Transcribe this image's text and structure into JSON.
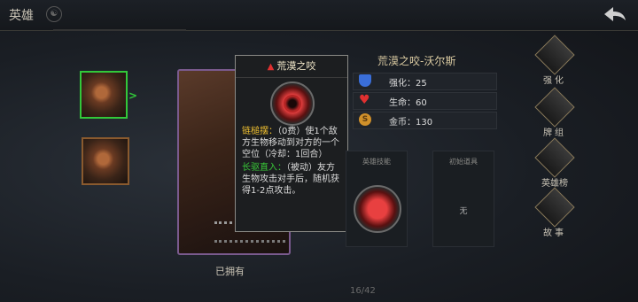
{
  "header": {
    "title": "英雄"
  },
  "card": {
    "owned_label": "已拥有"
  },
  "pagination": {
    "text": "16/42"
  },
  "tooltip": {
    "title": "荒漠之咬",
    "skill1_name": "链槌摆：",
    "skill1_desc": "（0费）使1个敌方生物移动到对方的一个空位（冷却：1回合）",
    "skill2_name": "长驱直入：",
    "skill2_desc": "（被动）友方生物攻击对手后，随机获得1-2点攻击。"
  },
  "hero": {
    "name": "荒漠之咬-沃尔斯",
    "stats": [
      {
        "label": "强化：",
        "value": "25",
        "icon": "shield-icon",
        "color": "#3a6ed8"
      },
      {
        "label": "生命：",
        "value": "60",
        "icon": "heart-icon",
        "color": "#e03030"
      },
      {
        "label": "金币：",
        "value": "130",
        "icon": "coin-icon",
        "color": "#d0902a"
      }
    ]
  },
  "panels": {
    "skill_title": "英雄技能",
    "item_title": "初始道具",
    "item_value": "无"
  },
  "menu": [
    {
      "label": "强化",
      "icon": "enhance-icon"
    },
    {
      "label": "牌组",
      "icon": "deck-icon"
    },
    {
      "label": "英雄榜",
      "icon": "ranking-icon"
    },
    {
      "label": "故事",
      "icon": "story-icon"
    }
  ],
  "colors": {
    "selection": "#32c83a",
    "accent_gold": "#f0c030",
    "accent_green": "#38c838"
  }
}
